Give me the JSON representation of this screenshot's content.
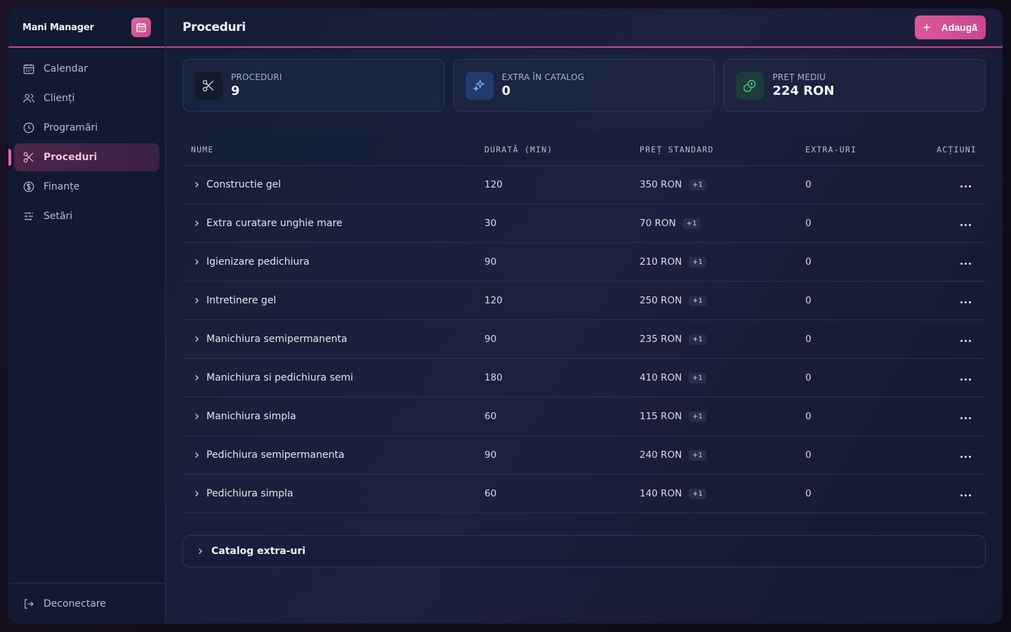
{
  "app": {
    "name": "Mani Manager"
  },
  "sidebar": {
    "items": [
      {
        "label": "Calendar",
        "icon": "calendar-icon",
        "active": false
      },
      {
        "label": "Clienți",
        "icon": "users-icon",
        "active": false
      },
      {
        "label": "Programări",
        "icon": "clock-icon",
        "active": false
      },
      {
        "label": "Proceduri",
        "icon": "scissors-icon",
        "active": true
      },
      {
        "label": "Finanțe",
        "icon": "dollar-circle-icon",
        "active": false
      },
      {
        "label": "Setări",
        "icon": "sliders-icon",
        "active": false
      }
    ],
    "logout_label": "Deconectare"
  },
  "header": {
    "title": "Proceduri",
    "add_label": "Adaugă"
  },
  "stats": [
    {
      "label": "PROCEDURI",
      "value": "9",
      "icon": "scissors-icon"
    },
    {
      "label": "EXTRA ÎN CATALOG",
      "value": "0",
      "icon": "sparkles-icon"
    },
    {
      "label": "PREȚ MEDIU",
      "value": "224 RON",
      "icon": "coins-icon"
    }
  ],
  "table": {
    "columns": [
      "NUME",
      "DURATĂ (MIN)",
      "PREȚ STANDARD",
      "EXTRA-URI",
      "ACȚIUNI"
    ],
    "rows": [
      {
        "name": "Constructie gel",
        "duration": "120",
        "price": "350 RON",
        "badge": "+1",
        "extras": "0"
      },
      {
        "name": "Extra curatare unghie mare",
        "duration": "30",
        "price": "70 RON",
        "badge": "+1",
        "extras": "0"
      },
      {
        "name": "Igienizare pedichiura",
        "duration": "90",
        "price": "210 RON",
        "badge": "+1",
        "extras": "0"
      },
      {
        "name": "Intretinere gel",
        "duration": "120",
        "price": "250 RON",
        "badge": "+1",
        "extras": "0"
      },
      {
        "name": "Manichiura semipermanenta",
        "duration": "90",
        "price": "235 RON",
        "badge": "+1",
        "extras": "0"
      },
      {
        "name": "Manichiura si pedichiura semi",
        "duration": "180",
        "price": "410 RON",
        "badge": "+1",
        "extras": "0"
      },
      {
        "name": "Manichiura simpla",
        "duration": "60",
        "price": "115 RON",
        "badge": "+1",
        "extras": "0"
      },
      {
        "name": "Pedichiura semipermanenta",
        "duration": "90",
        "price": "240 RON",
        "badge": "+1",
        "extras": "0"
      },
      {
        "name": "Pedichiura simpla",
        "duration": "60",
        "price": "140 RON",
        "badge": "+1",
        "extras": "0"
      }
    ]
  },
  "catalog": {
    "label": "Catalog extra-uri"
  },
  "colors": {
    "accent": "#d9579a",
    "background": "#141c33",
    "sidebar": "#111a30"
  }
}
